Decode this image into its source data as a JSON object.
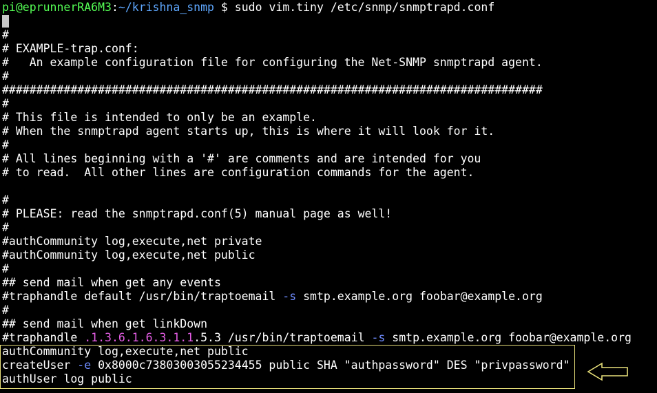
{
  "terminal": {
    "prompt": {
      "user_host": "pi@eprunnerRA6M3",
      "colon": ":",
      "path": "~/krishna_snmp",
      "dollar": " $ ",
      "command": "sudo vim.tiny /etc/snmp/snmptrapd.conf"
    },
    "lines": {
      "l01": "#",
      "l02": "# EXAMPLE-trap.conf:",
      "l03": "#   An example configuration file for configuring the Net-SNMP snmptrapd agent.",
      "l04": "#",
      "l05": "###############################################################################",
      "l06": "#",
      "l07": "# This file is intended to only be an example.",
      "l08": "# When the snmptrapd agent starts up, this is where it will look for it.",
      "l09": "#",
      "l10": "# All lines beginning with a '#' are comments and are intended for you",
      "l11": "# to read.  All other lines are configuration commands for the agent.",
      "l12": "",
      "l13": "#",
      "l14": "# PLEASE: read the snmptrapd.conf(5) manual page as well!",
      "l15": "#",
      "l16": "#authCommunity log,execute,net private",
      "l17": "#authCommunity log,execute,net public",
      "l18": "#",
      "l19": "## send mail when get any events",
      "l20_a": "#traphandle default /usr/bin/traptoemail ",
      "l20_flag": "-s",
      "l20_b": " smtp.example.org foobar@example.org",
      "l21": "#",
      "l22": "## send mail when get linkDown",
      "l23_a": "#traphandle ",
      "l23_oid": ".1.3.6.1.6.3.1.1",
      "l23_oid_rest": ".5.3",
      "l23_b": " /usr/bin/traptoemail ",
      "l23_flag": "-s",
      "l23_c": " smtp.example.org foobar@example.org",
      "l24": "authCommunity log,execute,net public",
      "l25_a": "createUser ",
      "l25_flag": "-e",
      "l25_b": " 0x8000c73803003055234455 public SHA \"authpassword\" DES \"privpassword\"",
      "l26": "authUser log public"
    },
    "annotation": {
      "box_color": "#e8e07a",
      "arrow_color": "#e8e07a",
      "arrow_icon": "left-arrow-icon"
    },
    "colors": {
      "background": "#000000",
      "text": "#ffffff",
      "prompt_user": "#55ff55",
      "prompt_path": "#5fa8ff",
      "flag": "#6f8cff",
      "oid": "#e45de4"
    }
  }
}
